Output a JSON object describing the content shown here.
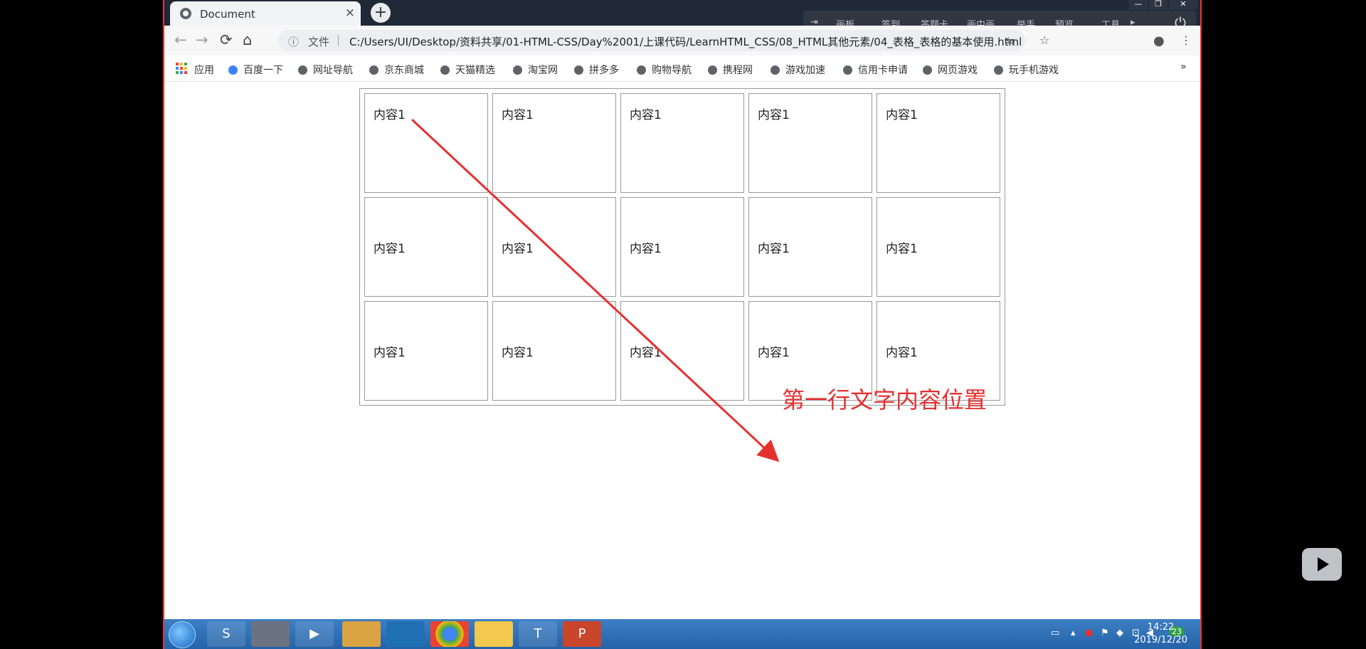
{
  "browser": {
    "tab_title": "Document",
    "tab_close": "×",
    "new_tab": "+",
    "window_controls": [
      "—",
      "❐",
      "✕"
    ],
    "floating_toolbar": {
      "items": [
        "画板",
        "签到",
        "答题卡",
        "画中画",
        "举手",
        "预览",
        "工具"
      ],
      "power": "⏻"
    },
    "address": {
      "info_icon": "ⓘ",
      "file_label": "文件",
      "separator": "|",
      "url": "C:/Users/UI/Desktop/资料共享/01-HTML-CSS/Day%2001/上课代码/LearnHTML_CSS/08_HTML其他元素/04_表格_表格的基本使用.html"
    },
    "nav": {
      "back": "←",
      "forward": "→",
      "reload": "⟳",
      "home": "⌂"
    },
    "omni_icons": {
      "translate": "⇆",
      "star": "☆",
      "profile": "●",
      "menu": "⋮"
    },
    "bookmarks": {
      "apps_label": "应用",
      "items": [
        "百度一下",
        "网址导航",
        "京东商城",
        "天猫精选",
        "淘宝网",
        "拼多多",
        "购物导航",
        "携程网",
        "游戏加速",
        "信用卡申请",
        "网页游戏",
        "玩手机游戏"
      ],
      "more": "»"
    }
  },
  "table": {
    "rows": [
      [
        "内容1",
        "内容1",
        "内容1",
        "内容1",
        "内容1"
      ],
      [
        "内容1",
        "内容1",
        "内容1",
        "内容1",
        "内容1"
      ],
      [
        "内容1",
        "内容1",
        "内容1",
        "内容1",
        "内容1"
      ]
    ]
  },
  "annotation": {
    "text": "第一行文字内容位置",
    "color": "#e53030"
  },
  "taskbar": {
    "apps": [
      "S",
      "",
      "▶",
      "",
      "",
      "",
      "",
      "T",
      "P"
    ],
    "tray": {
      "badge": "23"
    },
    "time": "14:22",
    "date": "2019/12/20"
  }
}
